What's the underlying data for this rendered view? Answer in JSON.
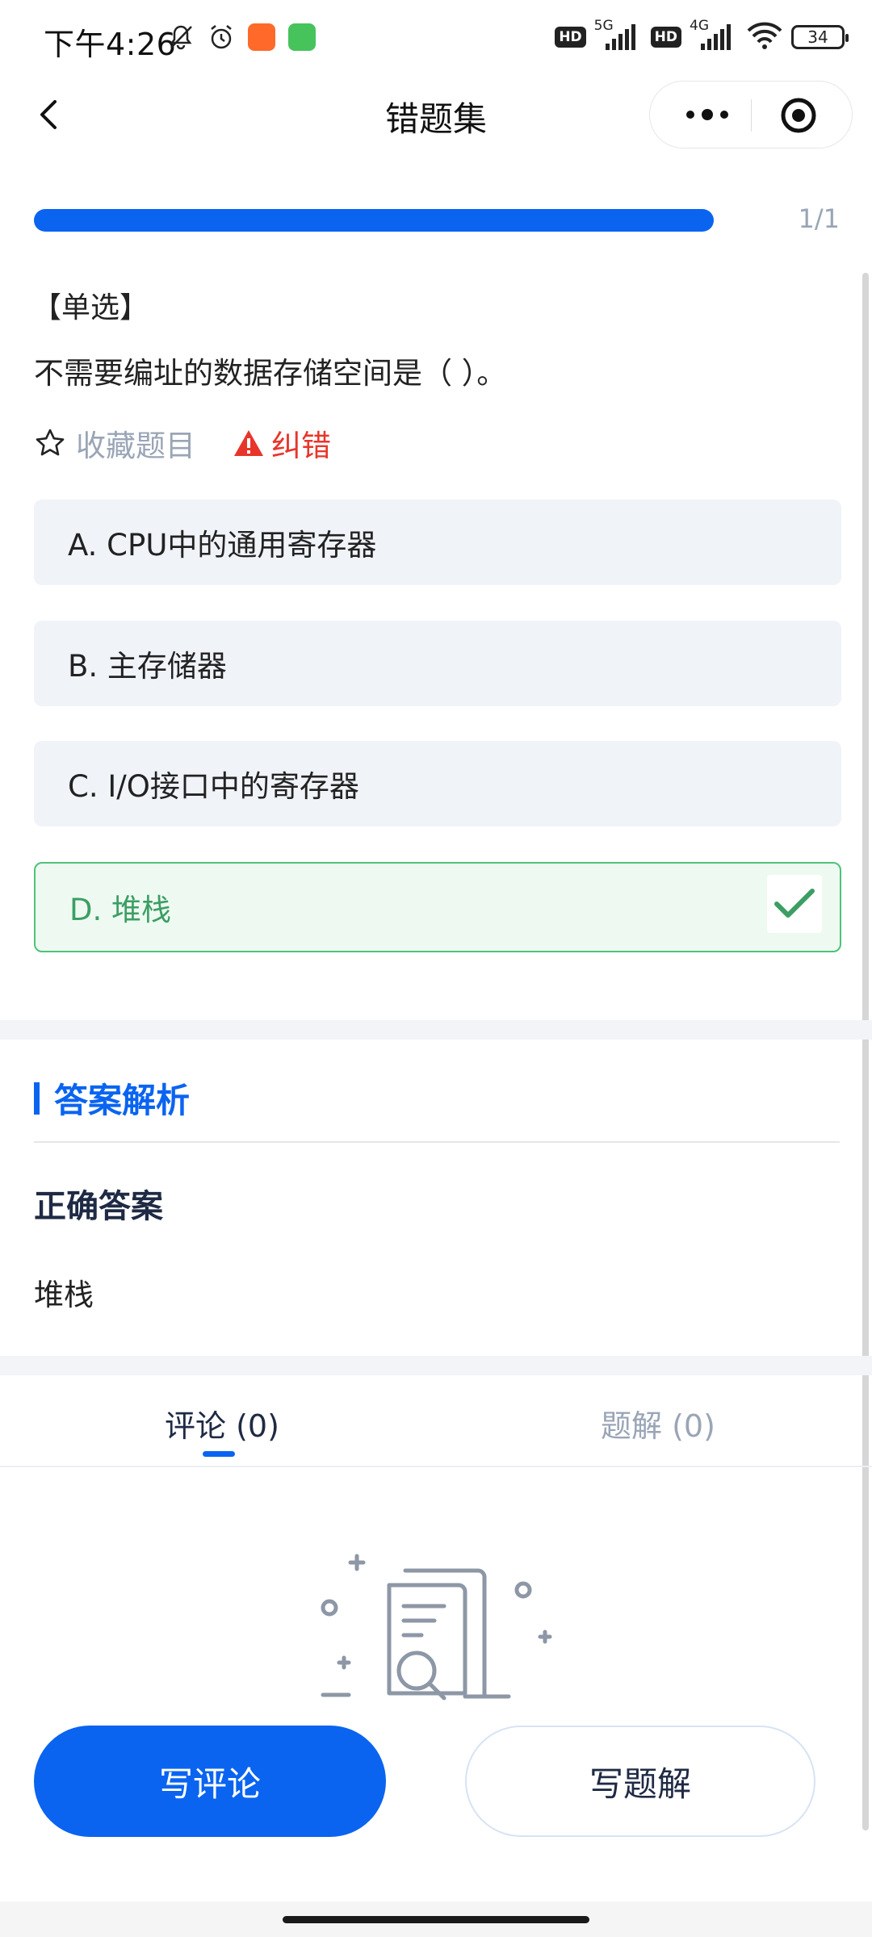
{
  "status_bar": {
    "time": "下午4:26",
    "network_5g": "5G",
    "network_4g": "4G",
    "hd_label": "HD",
    "battery": "34"
  },
  "nav": {
    "title": "错题集"
  },
  "progress": {
    "text": "1/1",
    "fraction": 1.0
  },
  "question": {
    "type": "【单选】",
    "text": "不需要编址的数据存储空间是（   ）。",
    "favorite_label": "收藏题目",
    "report_label": "纠错",
    "options": [
      {
        "label": "A. CPU中的通用寄存器",
        "correct": false
      },
      {
        "label": "B. 主存储器",
        "correct": false
      },
      {
        "label": "C. I/O接口中的寄存器",
        "correct": false
      },
      {
        "label": "D. 堆栈",
        "correct": true
      }
    ]
  },
  "analysis": {
    "title": "答案解析",
    "answer_label": "正确答案",
    "answer_value": "堆栈"
  },
  "tabs": [
    {
      "label": "评论 (0)",
      "active": true
    },
    {
      "label": "题解 (0)",
      "active": false
    }
  ],
  "buttons": {
    "write_comment": "写评论",
    "write_solution": "写题解"
  },
  "colors": {
    "accent": "#0a64f0",
    "correct": "#3c9e64",
    "warning": "#e8352b"
  }
}
